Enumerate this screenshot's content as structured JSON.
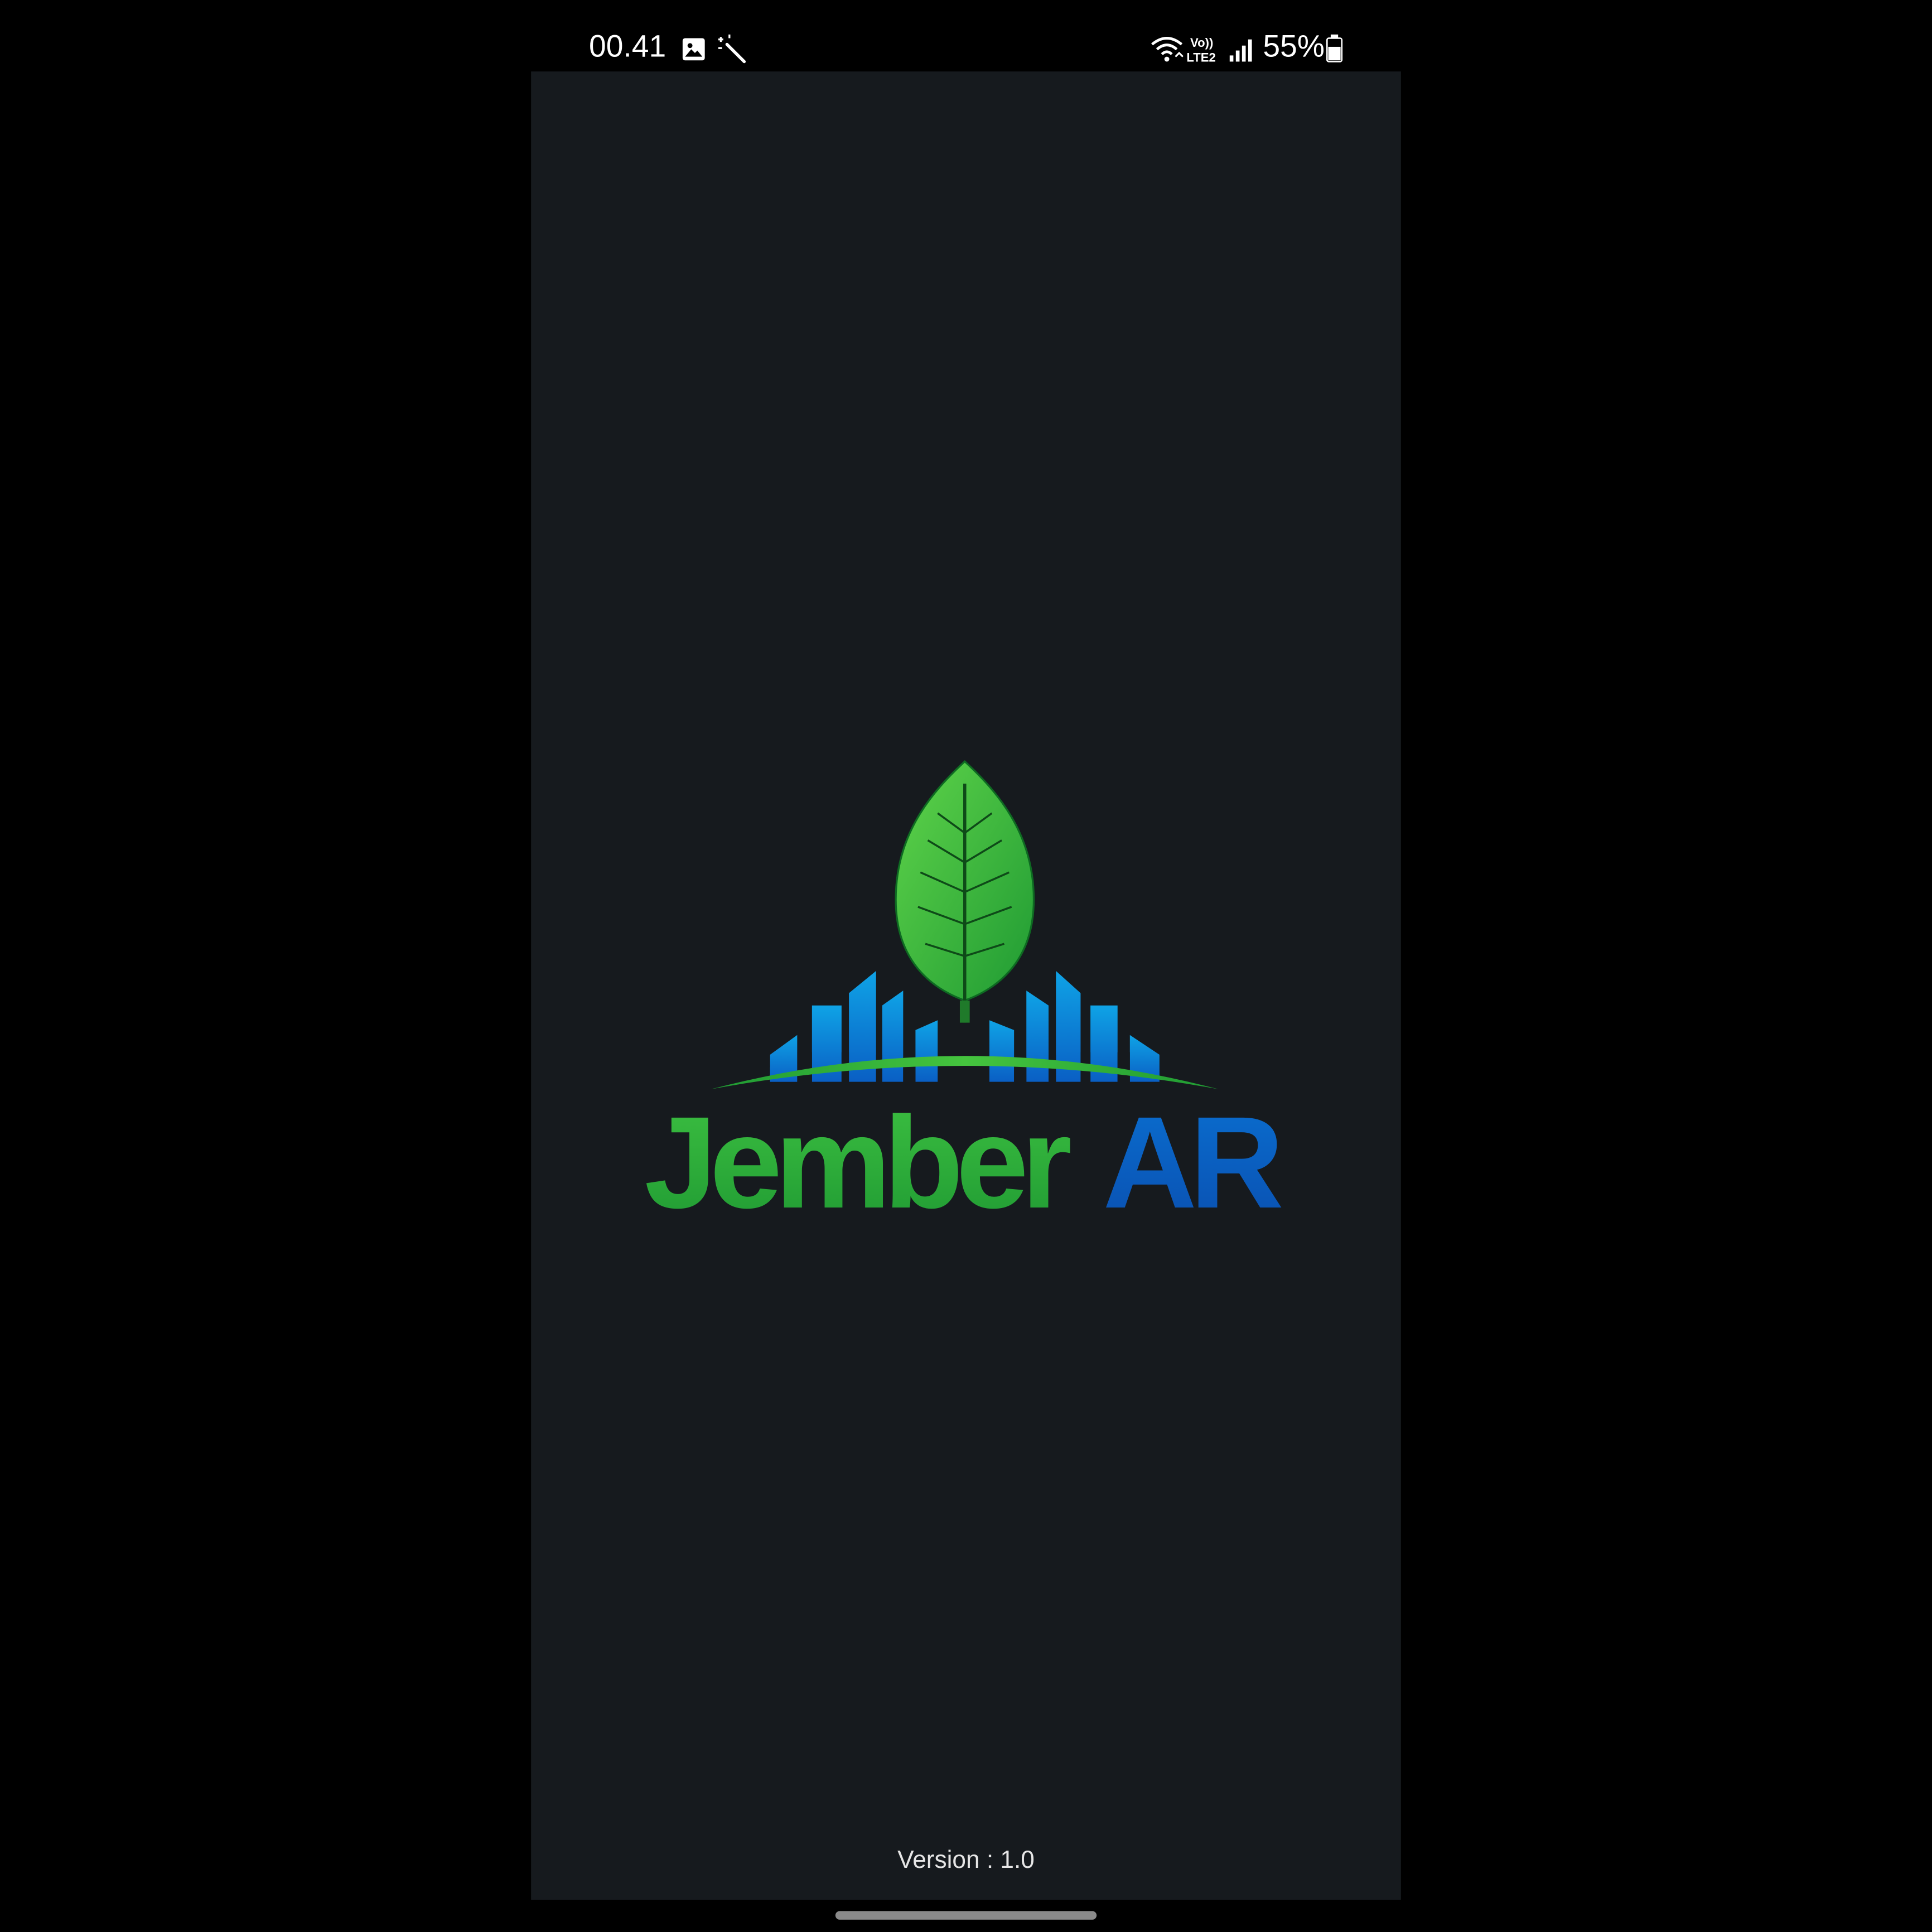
{
  "status_bar": {
    "time": "00.41",
    "battery": "55%",
    "icons": [
      "image-notification-icon",
      "magic-wand-icon",
      "wifi-icon",
      "volte-lte2-icon",
      "signal-icon",
      "battery-icon"
    ]
  },
  "splash": {
    "logo": {
      "brand_word": "Jember",
      "brand_suffix": "AR",
      "colors": {
        "green": "#2fae3b",
        "blue": "#0a5fc4",
        "buildings_top": "#0fa3e6",
        "buildings_bottom": "#0a5fc4"
      }
    },
    "version_label": "Version : 1.0"
  },
  "colors": {
    "screen_background": "#161a1e",
    "outer_background": "#000000"
  }
}
